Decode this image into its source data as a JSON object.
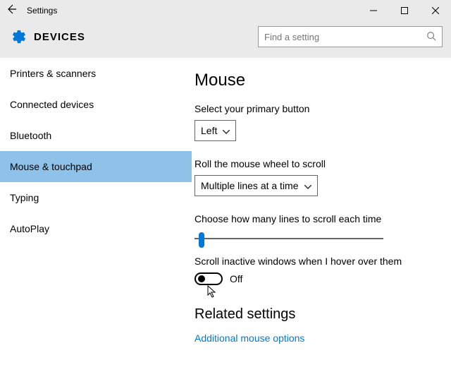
{
  "titlebar": {
    "title": "Settings"
  },
  "header": {
    "section": "DEVICES",
    "search_placeholder": "Find a setting"
  },
  "sidebar": {
    "items": [
      {
        "label": "Printers & scanners"
      },
      {
        "label": "Connected devices"
      },
      {
        "label": "Bluetooth"
      },
      {
        "label": "Mouse & touchpad"
      },
      {
        "label": "Typing"
      },
      {
        "label": "AutoPlay"
      }
    ],
    "selected_index": 3
  },
  "main": {
    "heading": "Mouse",
    "primary_button_label": "Select your primary button",
    "primary_button_value": "Left",
    "wheel_label": "Roll the mouse wheel to scroll",
    "wheel_value": "Multiple lines at a time",
    "lines_label": "Choose how many lines to scroll each time",
    "hover_label": "Scroll inactive windows when I hover over them",
    "hover_state": "Off",
    "related_heading": "Related settings",
    "related_link": "Additional mouse options"
  }
}
